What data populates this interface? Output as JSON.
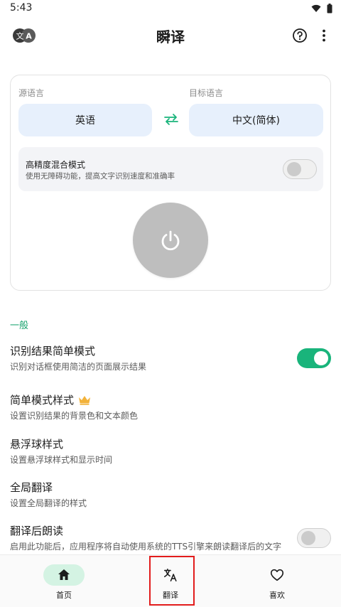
{
  "status": {
    "time": "5:43"
  },
  "app": {
    "title": "瞬译",
    "logo_left_glyph": "文",
    "logo_right_glyph": "A"
  },
  "card": {
    "source_label": "源语言",
    "target_label": "目标语言",
    "source_lang": "英语",
    "target_lang": "中文(简体)",
    "high_precision": {
      "title": "高精度混合模式",
      "description": "使用无障碍功能，提高文字识别速度和准确率",
      "enabled": false
    }
  },
  "settings": {
    "section_title": "一般",
    "items": [
      {
        "title": "识别结果简单模式",
        "subtitle": "识别对话框使用简洁的页面展示结果",
        "toggle": true
      },
      {
        "title": "简单模式样式",
        "subtitle": "设置识别结果的背景色和文本颜色",
        "icon": "crown-icon"
      },
      {
        "title": "悬浮球样式",
        "subtitle": "设置悬浮球样式和显示时间"
      },
      {
        "title": "全局翻译",
        "subtitle": "设置全局翻译的样式"
      },
      {
        "title": "翻译后朗读",
        "subtitle": "启用此功能后，应用程序将自动使用系统的TTS引擎来朗读翻译后的文字",
        "toggle": false
      }
    ]
  },
  "nav": {
    "items": [
      {
        "label": "首页",
        "icon": "home-icon",
        "active": true
      },
      {
        "label": "翻译",
        "icon": "translate-icon",
        "active": false
      },
      {
        "label": "喜欢",
        "icon": "heart-icon",
        "active": false
      }
    ]
  },
  "colors": {
    "accent_green": "#19b47b",
    "pill_blue": "#e7f0fc",
    "highlight_red": "#e21c1c",
    "nav_active_bg": "#d4f3e3"
  }
}
